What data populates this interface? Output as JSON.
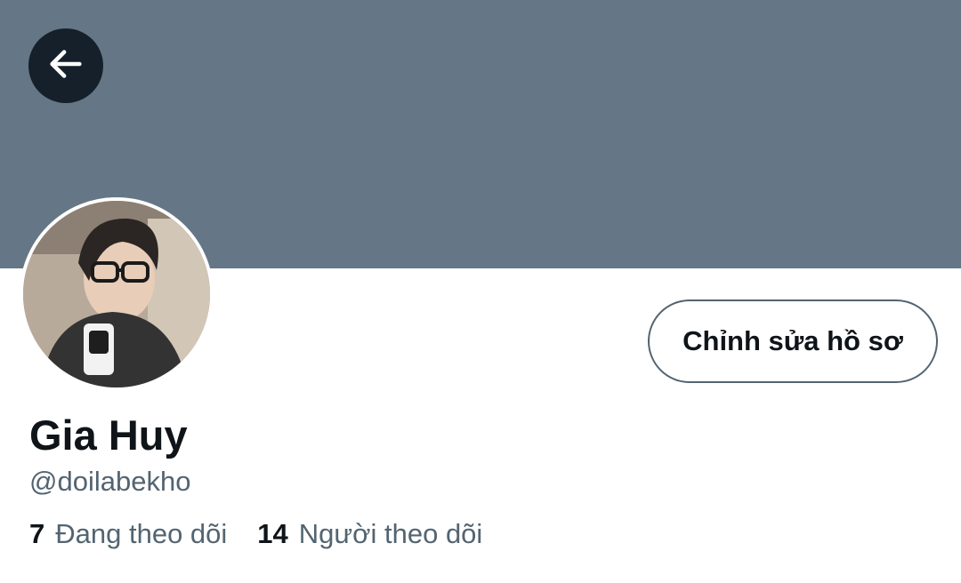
{
  "colors": {
    "banner": "#657786",
    "back_button_bg": "#15202b",
    "primary_text": "#0f1419",
    "secondary_text": "#536471",
    "button_border": "#536471"
  },
  "header": {
    "back_icon": "arrow-left-icon"
  },
  "profile": {
    "display_name": "Gia Huy",
    "handle": "@doilabekho",
    "edit_button_label": "Chỉnh sửa hồ sơ"
  },
  "stats": {
    "following_count": "7",
    "following_label": "Đang theo dõi",
    "followers_count": "14",
    "followers_label": "Người theo dõi"
  }
}
